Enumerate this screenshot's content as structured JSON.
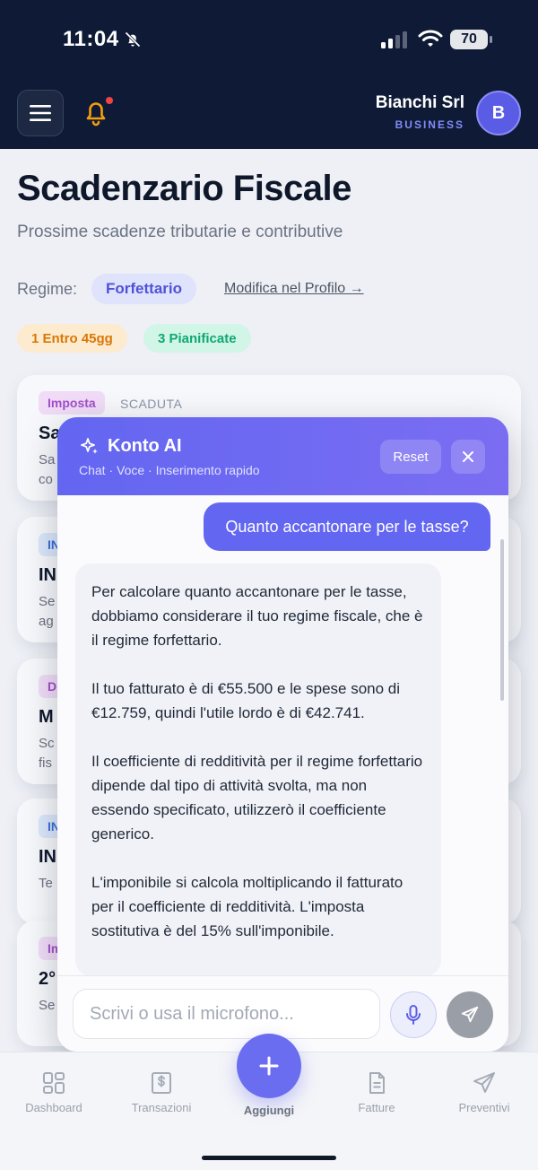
{
  "status_bar": {
    "time": "11:04",
    "battery": "70"
  },
  "header": {
    "company_name": "Bianchi Srl",
    "company_type": "BUSINESS",
    "avatar_initial": "B"
  },
  "page": {
    "title": "Scadenzario Fiscale",
    "subtitle": "Prossime scadenze tributarie e contributive",
    "regime_label": "Regime:",
    "regime_value": "Forfettario",
    "regime_link": "Modifica nel Profilo →",
    "badges": {
      "due": "1 Entro 45gg",
      "planned": "3 Pianificate"
    }
  },
  "cards": [
    {
      "tag": "Imposta",
      "status": "SCADUTA",
      "title": "Sa",
      "desc1": "Sa",
      "desc2": "co"
    },
    {
      "tag": "IN",
      "title": "IN",
      "desc1": "Se",
      "desc2": "ag"
    },
    {
      "tag": "D",
      "title": "M",
      "desc1": "Sc",
      "desc2": "fis"
    },
    {
      "tag": "IN",
      "title": "IN",
      "desc1": "Te",
      "desc2": ""
    },
    {
      "tag": "Im",
      "title": "2°",
      "desc1": "Se",
      "desc2": ""
    }
  ],
  "chat": {
    "title": "Konto AI",
    "subtitle": "Chat · Voce · Inserimento rapido",
    "reset_label": "Reset",
    "user_message": "Quanto accantonare per le tasse?",
    "bot_paragraphs": [
      "Per calcolare quanto accantonare per le tasse, dobbiamo considerare il tuo regime fiscale, che è il regime forfettario.",
      "Il tuo fatturato è di €55.500 e le spese sono di €12.759, quindi l'utile lordo è di €42.741.",
      "Il coefficiente di redditività per il regime forfettario dipende dal tipo di attività svolta, ma non essendo specificato, utilizzerò il coefficiente generico.",
      "L'imponibile si calcola moltiplicando il fatturato per il coefficiente di redditività. L'imposta sostitutiva è del 15% sull'imponibile."
    ],
    "input_placeholder": "Scrivi o usa il microfono..."
  },
  "bottom_nav": {
    "items": [
      "Dashboard",
      "Transazioni",
      "Aggiungi",
      "Fatture",
      "Preventivi"
    ]
  },
  "colors": {
    "accent": "#6366f1",
    "dark": "#0f1b36",
    "warning": "#f59e0b",
    "success": "#10a874"
  }
}
